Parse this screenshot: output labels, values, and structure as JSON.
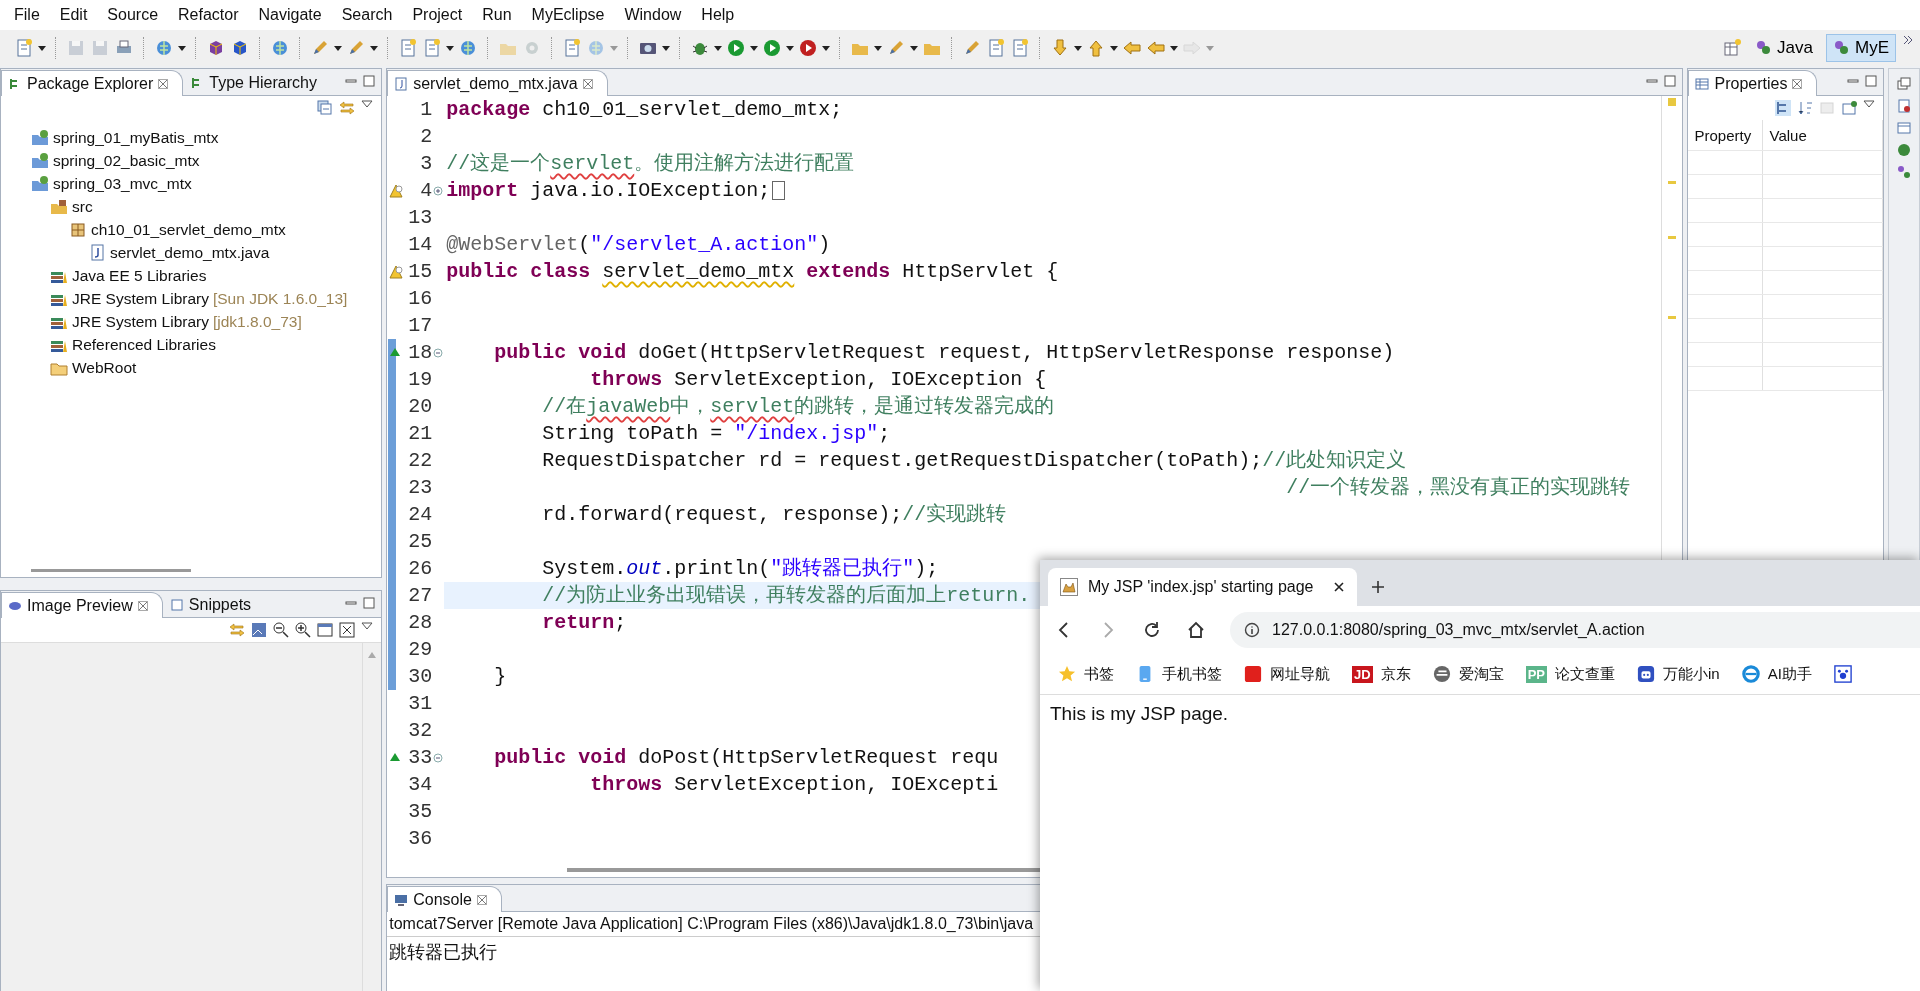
{
  "menu": [
    "File",
    "Edit",
    "Source",
    "Refactor",
    "Navigate",
    "Search",
    "Project",
    "Run",
    "MyEclipse",
    "Window",
    "Help"
  ],
  "perspectives": [
    {
      "label": "Java",
      "selected": false
    },
    {
      "label": "MyE",
      "selected": true
    }
  ],
  "package_explorer": {
    "tabs": [
      {
        "label": "Package Explorer",
        "selected": true
      },
      {
        "label": "Type Hierarchy",
        "selected": false
      }
    ],
    "tree": [
      {
        "kind": "project",
        "label": "spring_01_myBatis_mtx"
      },
      {
        "kind": "project",
        "label": "spring_02_basic_mtx"
      },
      {
        "kind": "project",
        "label": "spring_03_mvc_mtx",
        "children": [
          {
            "kind": "source-folder",
            "label": "src",
            "children": [
              {
                "kind": "package",
                "label": "ch10_01_servlet_demo_mtx",
                "children": [
                  {
                    "kind": "java-file",
                    "label": "servlet_demo_mtx.java"
                  }
                ]
              }
            ]
          },
          {
            "kind": "library",
            "label": "Java EE 5 Libraries"
          },
          {
            "kind": "library",
            "label": "JRE System Library",
            "decoration": "[Sun JDK 1.6.0_13]"
          },
          {
            "kind": "library",
            "label": "JRE System Library",
            "decoration": "[jdk1.8.0_73]"
          },
          {
            "kind": "library",
            "label": "Referenced Libraries"
          },
          {
            "kind": "folder",
            "label": "WebRoot"
          }
        ]
      }
    ]
  },
  "image_preview": {
    "tabs": [
      {
        "label": "Image Preview",
        "selected": true
      },
      {
        "label": "Snippets",
        "selected": false
      }
    ]
  },
  "editor": {
    "tabs": [
      {
        "label": "servlet_demo_mtx.java",
        "selected": true
      }
    ],
    "lines": [
      {
        "number": "1",
        "tokens": [
          {
            "kind": "keyword",
            "text": "package"
          },
          {
            "kind": "plain",
            "text": " ch10_01_servlet_demo_mtx;"
          }
        ]
      },
      {
        "number": "2"
      },
      {
        "number": "3",
        "tokens": [
          {
            "kind": "comment",
            "text": "//这是一个"
          },
          {
            "kind": "comment",
            "text": "servlet",
            "spelling_error": true
          },
          {
            "kind": "comment",
            "text": "。使用注解方法进行配置"
          }
        ]
      },
      {
        "number": "4",
        "warning": true,
        "foldable": true,
        "folded": true,
        "tokens": [
          {
            "kind": "keyword",
            "text": "import"
          },
          {
            "kind": "plain",
            "text": " java.io.IOException;"
          }
        ]
      },
      {
        "number": "13"
      },
      {
        "number": "14",
        "tokens": [
          {
            "kind": "annotation",
            "text": "@WebServlet"
          },
          {
            "kind": "plain",
            "text": "("
          },
          {
            "kind": "string",
            "text": "\"/servlet_A.action\""
          },
          {
            "kind": "plain",
            "text": ")"
          }
        ]
      },
      {
        "number": "15",
        "warning": true,
        "tokens": [
          {
            "kind": "keyword",
            "text": "public "
          },
          {
            "kind": "keyword",
            "text": "class "
          },
          {
            "kind": "plain",
            "text": "servlet_demo_mtx",
            "warning_underline": true
          },
          {
            "kind": "keyword",
            "text": " extends"
          },
          {
            "kind": "plain",
            "text": " HttpServlet {"
          }
        ]
      },
      {
        "number": "16"
      },
      {
        "number": "17"
      },
      {
        "number": "18",
        "override": true,
        "foldable": true,
        "in_range": true,
        "tokens": [
          {
            "kind": "keyword",
            "text": "    public "
          },
          {
            "kind": "keyword",
            "text": "void"
          },
          {
            "kind": "plain",
            "text": " doGet(HttpServletRequest request, HttpServletResponse response)"
          }
        ]
      },
      {
        "number": "19",
        "in_range": true,
        "tokens": [
          {
            "kind": "keyword",
            "text": "            throws"
          },
          {
            "kind": "plain",
            "text": " ServletException, IOException {"
          }
        ]
      },
      {
        "number": "20",
        "in_range": true,
        "tokens": [
          {
            "kind": "comment",
            "text": "        //在"
          },
          {
            "kind": "comment",
            "text": "javaWeb",
            "spelling_error": true
          },
          {
            "kind": "comment",
            "text": "中，"
          },
          {
            "kind": "comment",
            "text": "servlet",
            "spelling_error": true
          },
          {
            "kind": "comment",
            "text": "的跳转，是通过转发器完成的"
          }
        ]
      },
      {
        "number": "21",
        "in_range": true,
        "tokens": [
          {
            "kind": "plain",
            "text": "        String toPath = "
          },
          {
            "kind": "string",
            "text": "\"/index.jsp\""
          },
          {
            "kind": "plain",
            "text": ";"
          }
        ]
      },
      {
        "number": "22",
        "in_range": true,
        "tokens": [
          {
            "kind": "plain",
            "text": "        RequestDispatcher rd = request.getRequestDispatcher(toPath);"
          },
          {
            "kind": "comment",
            "text": "//此处知识定义"
          }
        ]
      },
      {
        "number": "23",
        "in_range": true,
        "tokens": [
          {
            "kind": "comment",
            "text": "                                                                      //一个转发器，黑没有真正的实现跳转"
          }
        ]
      },
      {
        "number": "24",
        "in_range": true,
        "tokens": [
          {
            "kind": "plain",
            "text": "        rd.forward(request, response);"
          },
          {
            "kind": "comment",
            "text": "//实现跳转"
          }
        ]
      },
      {
        "number": "25",
        "in_range": true
      },
      {
        "number": "26",
        "in_range": true,
        "tokens": [
          {
            "kind": "plain",
            "text": "        System."
          },
          {
            "kind": "field",
            "text": "out"
          },
          {
            "kind": "plain",
            "text": ".println("
          },
          {
            "kind": "string",
            "text": "\"跳转器已执行\""
          },
          {
            "kind": "plain",
            "text": ");"
          }
        ]
      },
      {
        "number": "27",
        "current": true,
        "in_range": true,
        "tokens": [
          {
            "kind": "comment",
            "text": "        //为防止业务出现错误，再转发器的后面加上return."
          }
        ]
      },
      {
        "number": "28",
        "in_range": true,
        "tokens": [
          {
            "kind": "keyword",
            "text": "        return"
          },
          {
            "kind": "plain",
            "text": ";"
          }
        ]
      },
      {
        "number": "29",
        "in_range": true
      },
      {
        "number": "30",
        "in_range": true,
        "tokens": [
          {
            "kind": "plain",
            "text": "    }"
          }
        ]
      },
      {
        "number": "31"
      },
      {
        "number": "32"
      },
      {
        "number": "33",
        "override": true,
        "foldable": true,
        "tokens": [
          {
            "kind": "keyword",
            "text": "    public "
          },
          {
            "kind": "keyword",
            "text": "void"
          },
          {
            "kind": "plain",
            "text": " doPost(HttpServletRequest requ"
          }
        ]
      },
      {
        "number": "34",
        "tokens": [
          {
            "kind": "keyword",
            "text": "            throws"
          },
          {
            "kind": "plain",
            "text": " ServletException, IOExcepti"
          }
        ]
      },
      {
        "number": "35"
      },
      {
        "number": "36"
      }
    ]
  },
  "console": {
    "tabs": [
      {
        "label": "Console",
        "selected": true
      }
    ],
    "process": "tomcat7Server [Remote Java Application] C:\\Program Files (x86)\\Java\\jdk1.8.0_73\\bin\\java",
    "output": "跳转器已执行"
  },
  "properties": {
    "tabs": [
      {
        "label": "Properties",
        "selected": true
      }
    ],
    "columns": [
      "Property",
      "Value"
    ]
  },
  "browser": {
    "tabs": [
      {
        "label": "My JSP 'index.jsp' starting page",
        "selected": true
      }
    ],
    "nav": [
      {
        "kind": "back",
        "disabled": false
      },
      {
        "kind": "forward",
        "disabled": true
      },
      {
        "kind": "reload",
        "disabled": false
      },
      {
        "kind": "home",
        "disabled": false
      }
    ],
    "url": "127.0.0.1:8080/spring_03_mvc_mtx/servlet_A.action",
    "bookmarks": [
      {
        "kind": "star",
        "label": "书签"
      },
      {
        "kind": "phone",
        "label": "手机书签"
      },
      {
        "kind": "square",
        "color": "#e0201c",
        "label": "网址导航"
      },
      {
        "kind": "badge",
        "badge": "JD",
        "color": "#c8161d",
        "label": "京东"
      },
      {
        "kind": "swirl",
        "label": "爱淘宝"
      },
      {
        "kind": "badge",
        "badge": "PP",
        "color": "#5bb58a",
        "label": "论文查重"
      },
      {
        "kind": "robot",
        "label": "万能小in"
      },
      {
        "kind": "edge",
        "label": "AI助手"
      },
      {
        "kind": "paw"
      }
    ],
    "page_text": "This is my JSP page."
  }
}
